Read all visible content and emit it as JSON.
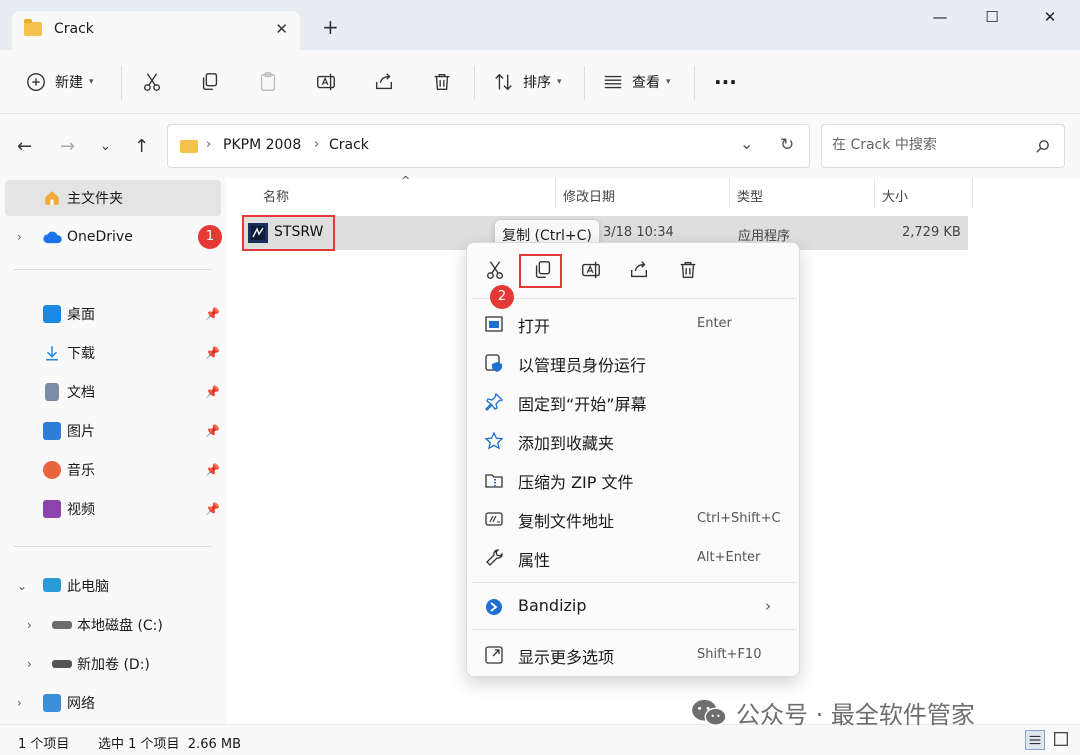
{
  "window": {
    "tab_title": "Crack",
    "controls": {
      "minimize": "—",
      "maximize": "☐",
      "close": "✕"
    }
  },
  "toolbar": {
    "new_label": "新建",
    "sort_label": "排序",
    "view_label": "查看",
    "more_label": "···"
  },
  "address": {
    "crumbs": [
      "PKPM 2008",
      "Crack"
    ],
    "search_placeholder": "在 Crack 中搜索"
  },
  "sidebar": {
    "home": "主文件夹",
    "onedrive": "OneDrive",
    "quick": [
      {
        "label": "桌面",
        "icon": "desktop-icon",
        "color": "#1e88e5"
      },
      {
        "label": "下载",
        "icon": "download-icon",
        "color": "#1e88e5"
      },
      {
        "label": "文档",
        "icon": "document-icon",
        "color": "#7a8ca5"
      },
      {
        "label": "图片",
        "icon": "pictures-icon",
        "color": "#2e7dd7"
      },
      {
        "label": "音乐",
        "icon": "music-icon",
        "color": "#e8643c"
      },
      {
        "label": "视频",
        "icon": "video-icon",
        "color": "#8e44ad"
      }
    ],
    "this_pc": "此电脑",
    "drive_c": "本地磁盘 (C:)",
    "drive_d": "新加卷 (D:)",
    "network": "网络"
  },
  "columns": {
    "name": "名称",
    "modified": "修改日期",
    "type": "类型",
    "size": "大小"
  },
  "file": {
    "name": "STSRW",
    "modified": "3/18 10:34",
    "type": "应用程序",
    "size": "2,729 KB"
  },
  "tooltip": "复制 (Ctrl+C)",
  "badges": [
    "1",
    "2"
  ],
  "menu": {
    "items": [
      {
        "label": "打开",
        "shortcut": "Enter"
      },
      {
        "label": "以管理员身份运行",
        "shortcut": ""
      },
      {
        "label": "固定到“开始”屏幕",
        "shortcut": ""
      },
      {
        "label": "添加到收藏夹",
        "shortcut": ""
      },
      {
        "label": "压缩为 ZIP 文件",
        "shortcut": ""
      },
      {
        "label": "复制文件地址",
        "shortcut": "Ctrl+Shift+C"
      },
      {
        "label": "属性",
        "shortcut": "Alt+Enter"
      }
    ],
    "bandizip": "Bandizip",
    "more": {
      "label": "显示更多选项",
      "shortcut": "Shift+F10"
    }
  },
  "status": {
    "count": "1 个项目",
    "selection": "选中 1 个项目  2.66 MB"
  },
  "watermark": "公众号 · 最全软件管家",
  "colors": {
    "accent": "#0067c0",
    "highlight": "#e53935",
    "folder": "#f4c24d"
  }
}
